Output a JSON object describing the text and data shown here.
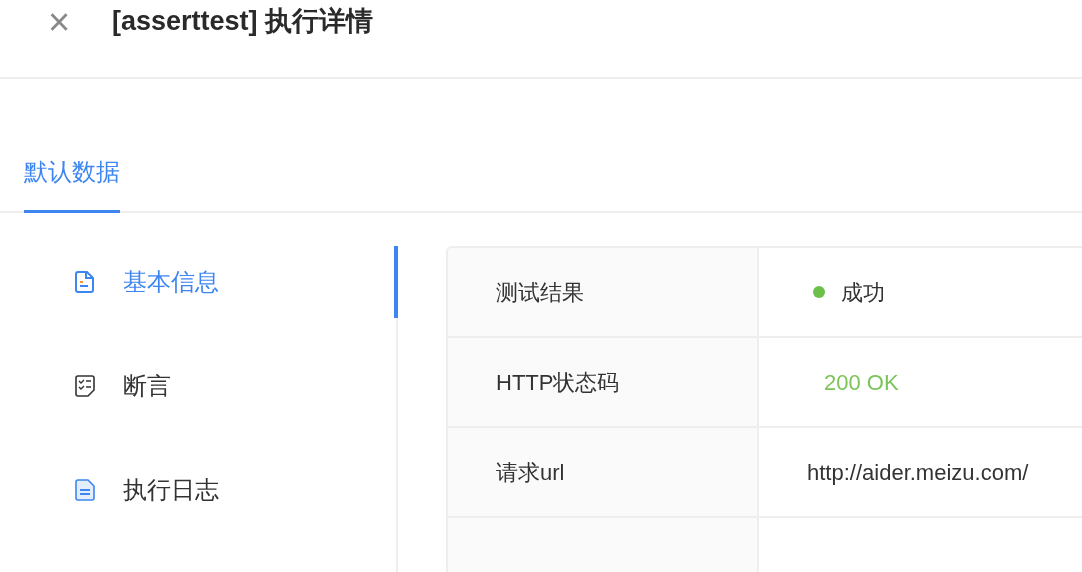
{
  "header": {
    "close": "×",
    "title": "[asserttest] 执行详情"
  },
  "tabs": [
    {
      "label": "默认数据",
      "selected": true
    }
  ],
  "sidebar": {
    "items": [
      {
        "label": "基本信息",
        "kind": "info",
        "selected": true
      },
      {
        "label": "断言",
        "kind": "assert",
        "selected": false
      },
      {
        "label": "执行日志",
        "kind": "log",
        "selected": false
      }
    ]
  },
  "table": {
    "rows": [
      {
        "label": "测试结果",
        "kind": "status",
        "value": "成功",
        "color": "#6cc04a"
      },
      {
        "label": "HTTP状态码",
        "kind": "code",
        "value": "200 OK",
        "color": "#7cc35a"
      },
      {
        "label": "请求url",
        "kind": "text",
        "value": "http://aider.meizu.com/"
      }
    ]
  }
}
